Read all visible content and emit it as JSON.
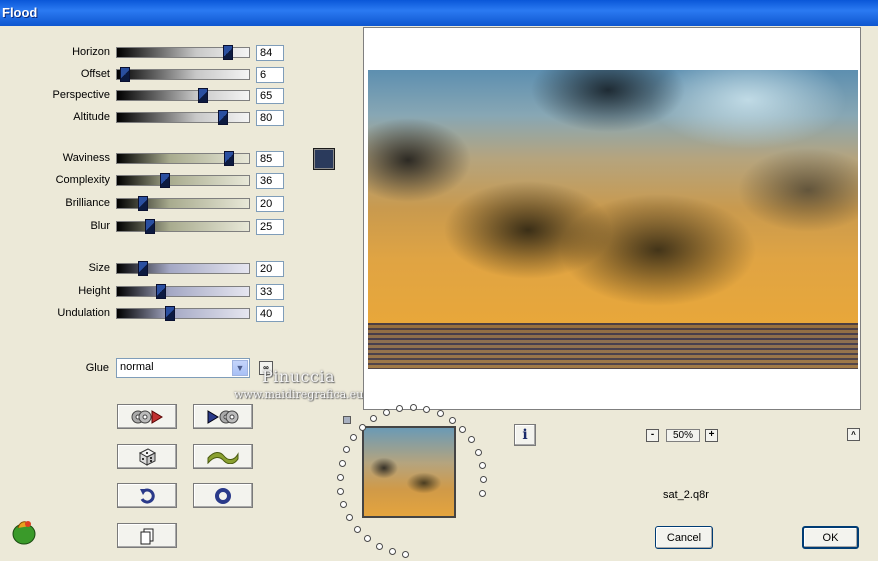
{
  "window": {
    "title": "Flood"
  },
  "sliders": [
    {
      "label": "Horizon",
      "value": "84",
      "level": 0.84,
      "style": "g1"
    },
    {
      "label": "Offset",
      "value": "6",
      "level": 0.06,
      "style": "g1"
    },
    {
      "label": "Perspective",
      "value": "65",
      "level": 0.65,
      "style": "g1"
    },
    {
      "label": "Altitude",
      "value": "80",
      "level": 0.8,
      "style": "g1"
    },
    {
      "label": "Waviness",
      "value": "85",
      "level": 0.85,
      "style": "g2"
    },
    {
      "label": "Complexity",
      "value": "36",
      "level": 0.36,
      "style": "g2"
    },
    {
      "label": "Brilliance",
      "value": "20",
      "level": 0.2,
      "style": "g2"
    },
    {
      "label": "Blur",
      "value": "25",
      "level": 0.25,
      "style": "g2"
    },
    {
      "label": "Size",
      "value": "20",
      "level": 0.2,
      "style": "g3"
    },
    {
      "label": "Height",
      "value": "33",
      "level": 0.33,
      "style": "g3"
    },
    {
      "label": "Undulation",
      "value": "40",
      "level": 0.4,
      "style": "g3"
    }
  ],
  "color_swatch": "#2a3a5c",
  "glue": {
    "label": "Glue",
    "value": "normal"
  },
  "watermark": {
    "line1": "Pinuccia",
    "line2": "www.maidiregrafica.eu"
  },
  "toolbar_icons": [
    "reset-play-icon",
    "play-reset-icon",
    "dice-icon",
    "wave-icon",
    "undo-icon",
    "ring-icon",
    "copy-icon"
  ],
  "zoom": {
    "minus": "-",
    "value": "50%",
    "plus": "+"
  },
  "filename": "sat_2.q8r",
  "buttons": {
    "cancel": "Cancel",
    "ok": "OK",
    "info": "i",
    "up": "^"
  }
}
